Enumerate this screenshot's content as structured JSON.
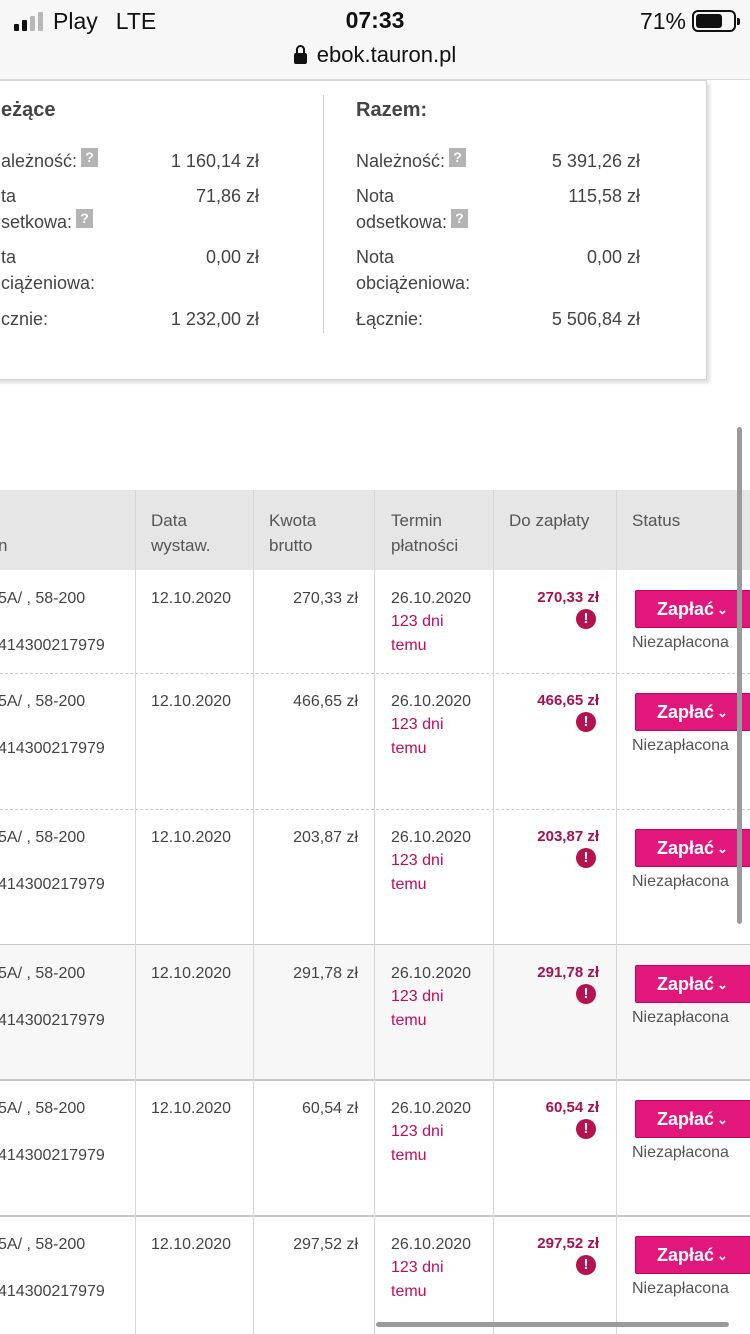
{
  "status_bar": {
    "carrier": "Play",
    "network": "LTE",
    "time": "07:33",
    "battery": "71%",
    "battery_level": 0.71,
    "url": "ebok.tauron.pl"
  },
  "summary": {
    "current": {
      "title": "eżące",
      "rows": [
        {
          "label": "ależność:",
          "help": "?",
          "value": "1 160,14 zł"
        },
        {
          "label_line1": "ta",
          "label_line2": "setkowa:",
          "help": "?",
          "value": "71,86 zł"
        },
        {
          "label_line1": "ta",
          "label_line2": "ciążeniowa:",
          "value": "0,00 zł"
        },
        {
          "label": "cznie:",
          "value": "1 232,00 zł"
        }
      ]
    },
    "total": {
      "title": "Razem:",
      "rows": [
        {
          "label": "Należność:",
          "help": "?",
          "value": "5 391,26 zł"
        },
        {
          "label_line1": "Nota",
          "label_line2": "odsetkowa:",
          "help": "?",
          "value": "115,58 zł"
        },
        {
          "label_line1": "Nota",
          "label_line2": "obciążeniowa:",
          "value": "0,00 zł"
        },
        {
          "label": "Łącznie:",
          "value": "5 506,84 zł"
        }
      ]
    }
  },
  "table": {
    "headers": {
      "address_partial": "n",
      "issue_date_line1": "Data",
      "issue_date_line2": "wystaw.",
      "gross_line1": "Kwota",
      "gross_line2": "brutto",
      "due_line1": "Termin",
      "due_line2": "płatności",
      "to_pay": "Do zapłaty",
      "status": "Status"
    },
    "rows": [
      {
        "address": "5A/ , 58-200",
        "account": "414300217979",
        "issue_date": "12.10.2020",
        "gross": "270,33 zł",
        "due_date": "26.10.2020",
        "overdue_line1": "123 dni",
        "overdue_line2": "temu",
        "to_pay": "270,33 zł",
        "alert": "!",
        "pay_label": "Zapłać",
        "pay_chevron": "⌄",
        "status": "Niezapłacona"
      },
      {
        "address": "5A/ , 58-200",
        "account": "414300217979",
        "issue_date": "12.10.2020",
        "gross": "466,65 zł",
        "due_date": "26.10.2020",
        "overdue_line1": "123 dni",
        "overdue_line2": "temu",
        "to_pay": "466,65 zł",
        "alert": "!",
        "pay_label": "Zapłać",
        "pay_chevron": "⌄",
        "status": "Niezapłacona"
      },
      {
        "address": "5A/ , 58-200",
        "account": "414300217979",
        "issue_date": "12.10.2020",
        "gross": "203,87 zł",
        "due_date": "26.10.2020",
        "overdue_line1": "123 dni",
        "overdue_line2": "temu",
        "to_pay": "203,87 zł",
        "alert": "!",
        "pay_label": "Zapłać",
        "pay_chevron": "⌄",
        "status": "Niezapłacona"
      },
      {
        "address": "5A/ , 58-200",
        "account": "414300217979",
        "issue_date": "12.10.2020",
        "gross": "291,78 zł",
        "due_date": "26.10.2020",
        "overdue_line1": "123 dni",
        "overdue_line2": "temu",
        "to_pay": "291,78 zł",
        "alert": "!",
        "pay_label": "Zapłać",
        "pay_chevron": "⌄",
        "status": "Niezapłacona"
      },
      {
        "address": "5A/ , 58-200",
        "account": "414300217979",
        "issue_date": "12.10.2020",
        "gross": "60,54 zł",
        "due_date": "26.10.2020",
        "overdue_line1": "123 dni",
        "overdue_line2": "temu",
        "to_pay": "60,54 zł",
        "alert": "!",
        "pay_label": "Zapłać",
        "pay_chevron": "⌄",
        "status": "Niezapłacona"
      },
      {
        "address": "5A/ , 58-200",
        "account": "414300217979",
        "issue_date": "12.10.2020",
        "gross": "297,52 zł",
        "due_date": "26.10.2020",
        "overdue_line1": "123 dni",
        "overdue_line2": "temu",
        "to_pay": "297,52 zł",
        "alert": "!",
        "pay_label": "Zapłać",
        "pay_chevron": "⌄",
        "status": "Niezapłacona"
      }
    ]
  },
  "colors": {
    "accent": "#e2177b",
    "due_amount": "#a6124f",
    "overdue_text": "#c40c55"
  }
}
